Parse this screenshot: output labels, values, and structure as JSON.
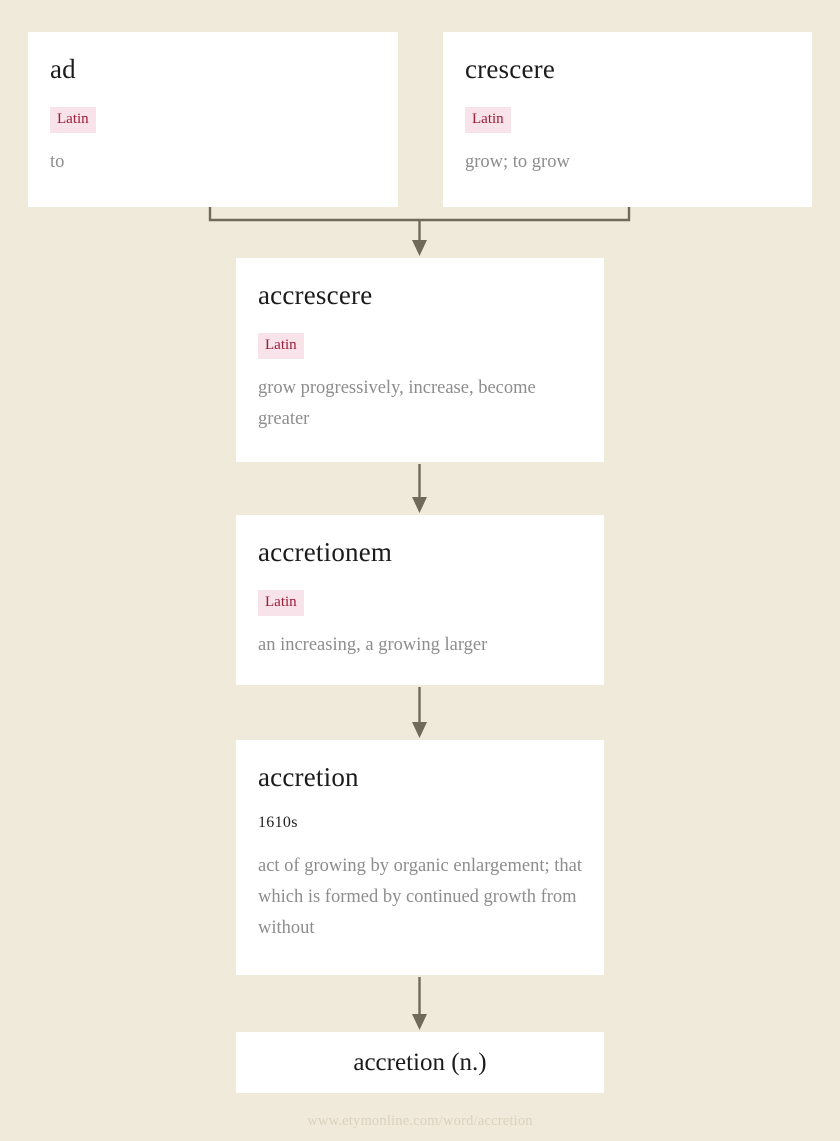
{
  "page": {
    "background_color": "#f0eada",
    "card_color": "#ffffff",
    "connector_color": "#6f6a59",
    "tag_background_color": "#f9e3ea",
    "tag_text_color": "#9c1b38",
    "gloss_text_color": "#8d8d8d",
    "title_text_color": "#1b1b1b",
    "footer_text_color": "#d9d2be"
  },
  "cards": {
    "ad": {
      "title": "ad",
      "language": "Latin",
      "gloss": "to"
    },
    "crescere": {
      "title": "crescere",
      "language": "Latin",
      "gloss": "grow; to grow"
    },
    "accrescere": {
      "title": "accrescere",
      "language": "Latin",
      "gloss": "grow progressively, increase, become greater"
    },
    "accretionem": {
      "title": "accretionem",
      "language": "Latin",
      "gloss": "an increasing, a growing larger"
    },
    "accretion": {
      "title": "accretion",
      "date": "1610s",
      "gloss": "act of growing by organic enlargement; that which is formed by continued growth from without"
    },
    "headword": {
      "title": "accretion (n.)"
    }
  },
  "footer": {
    "url": "www.etymonline.com/word/accretion"
  }
}
